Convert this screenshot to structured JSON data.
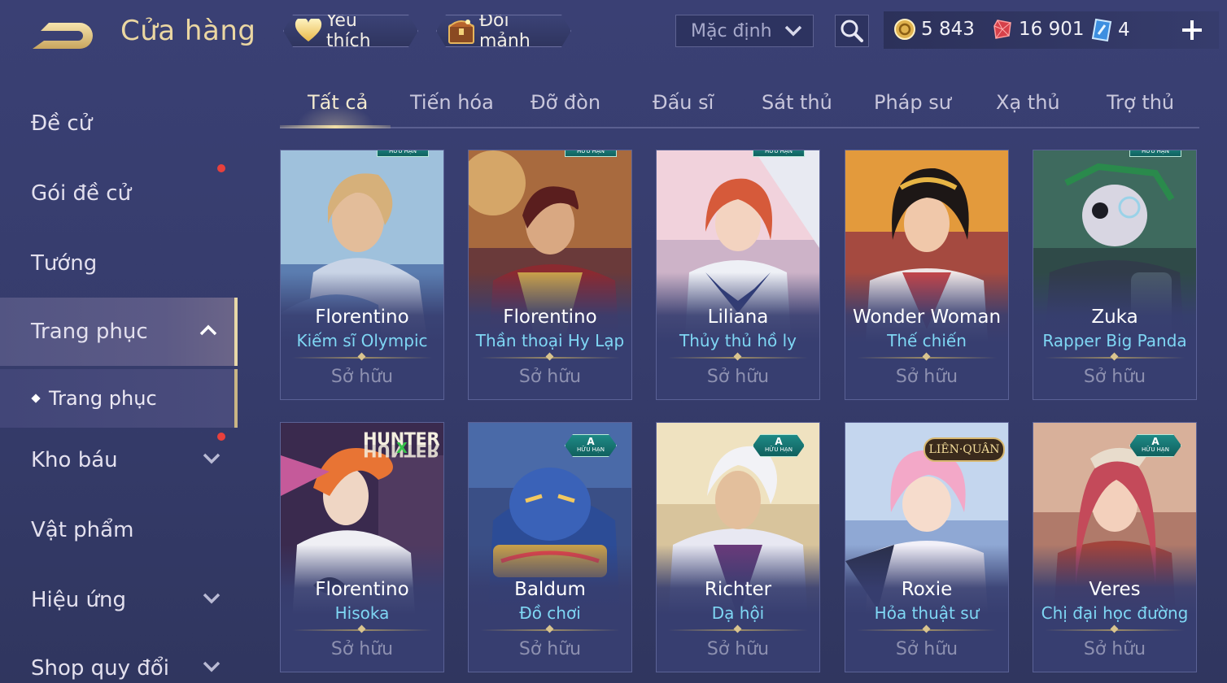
{
  "header": {
    "title": "Cửa hàng",
    "favorites_label": "Yêu thích",
    "exchange_label": "Đổi mảnh",
    "sort": {
      "selected": "Mặc định"
    },
    "currencies": {
      "gold": "5 843",
      "vouchers": "16 901",
      "tickets": "4"
    }
  },
  "sidebar": {
    "items": [
      {
        "label": "Đề cử"
      },
      {
        "label": "Gói đề cử"
      },
      {
        "label": "Tướng"
      },
      {
        "label": "Trang phục"
      },
      {
        "label": "Trang phục"
      },
      {
        "label": "Kho báu"
      },
      {
        "label": "Vật phẩm"
      },
      {
        "label": "Hiệu ứng"
      },
      {
        "label": "Shop quy đổi"
      }
    ]
  },
  "tabs": [
    {
      "label": "Tất cả"
    },
    {
      "label": "Tiến hóa"
    },
    {
      "label": "Đỡ đòn"
    },
    {
      "label": "Đấu sĩ"
    },
    {
      "label": "Sát thủ"
    },
    {
      "label": "Pháp sư"
    },
    {
      "label": "Xạ thủ"
    },
    {
      "label": "Trợ thủ"
    }
  ],
  "cards": [
    {
      "hero": "Florentino",
      "skin": "Kiếm sĩ Olympic",
      "status": "Sở hữu"
    },
    {
      "hero": "Florentino",
      "skin": "Thần thoại Hy Lạp",
      "status": "Sở hữu"
    },
    {
      "hero": "Liliana",
      "skin": "Thủy thủ hồ ly",
      "status": "Sở hữu"
    },
    {
      "hero": "Wonder Woman",
      "skin": "Thế chiến",
      "status": "Sở hữu"
    },
    {
      "hero": "Zuka",
      "skin": "Rapper Big Panda",
      "status": "Sở hữu"
    },
    {
      "hero": "Florentino",
      "skin": "Hisoka",
      "status": "Sở hữu",
      "logo": "HUNTER",
      "logo_x": "X"
    },
    {
      "hero": "Baldum",
      "skin": "Đồ chơi",
      "status": "Sở hữu",
      "badge": "A",
      "badge_sub": "HỮU HẠN"
    },
    {
      "hero": "Richter",
      "skin": "Dạ hội",
      "status": "Sở hữu",
      "badge": "A",
      "badge_sub": "HỮU HẠN"
    },
    {
      "hero": "Roxie",
      "skin": "Hỏa thuật sư",
      "status": "Sở hữu",
      "logo": "LIÊN·QUÂN"
    },
    {
      "hero": "Veres",
      "skin": "Chị đại học đường",
      "status": "Sở hữu",
      "badge": "A",
      "badge_sub": "HỮU HẠN"
    }
  ],
  "top_row_badges": [
    "HỮU HẠN",
    "HỮU HẠN",
    "HỮU HẠN",
    "",
    "HỮU HẠN"
  ],
  "theme": {
    "accent_gold": "#ebd7a2",
    "skin_name_color": "#7fd7f4",
    "badge_color": "#1e8a86",
    "notification_dot": "#e8403c"
  }
}
